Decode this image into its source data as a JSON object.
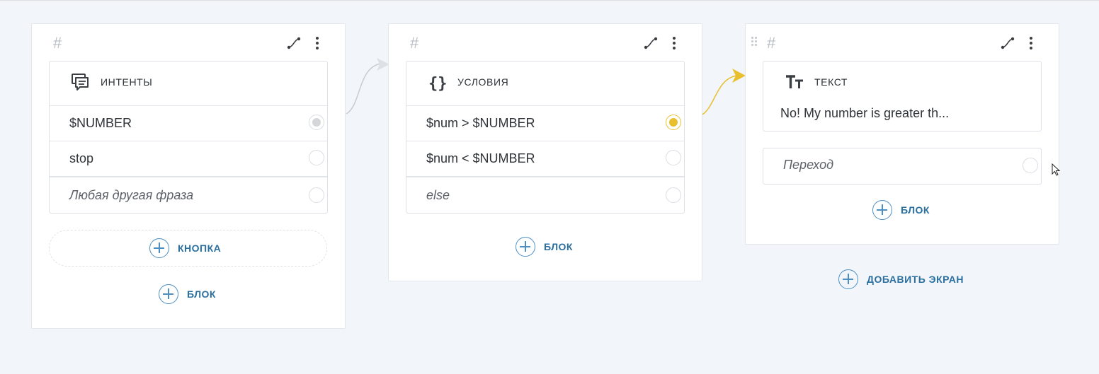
{
  "screens": [
    {
      "hash": "#",
      "block": {
        "title": "интенты",
        "icon": "chat-bubbles-icon",
        "rows": [
          {
            "label": "$NUMBER",
            "state": "grey"
          },
          {
            "label": "stop",
            "state": "empty"
          },
          {
            "label": "Любая другая фраза",
            "state": "empty",
            "italic": true
          }
        ]
      },
      "add_button_label": "кнопка",
      "add_block_label": "блок"
    },
    {
      "hash": "#",
      "block": {
        "title": "условия",
        "icon": "braces-icon",
        "rows": [
          {
            "label": "$num > $NUMBER",
            "state": "yellow"
          },
          {
            "label": "$num < $NUMBER",
            "state": "empty"
          },
          {
            "label": "else",
            "state": "empty",
            "italic": true
          }
        ]
      },
      "add_block_label": "блок"
    },
    {
      "hash": "#",
      "block": {
        "title": "текст",
        "icon": "text-format-icon",
        "preview": "No! My number is greater th..."
      },
      "transition": {
        "placeholder": "Переход"
      },
      "add_block_label": "блок"
    }
  ],
  "add_screen_label": "добавить экран",
  "colors": {
    "background": "#f2f5f9",
    "accent": "#2b6f9f",
    "active_link": "#e8bf2c",
    "link_grey": "#c8ccd1"
  }
}
